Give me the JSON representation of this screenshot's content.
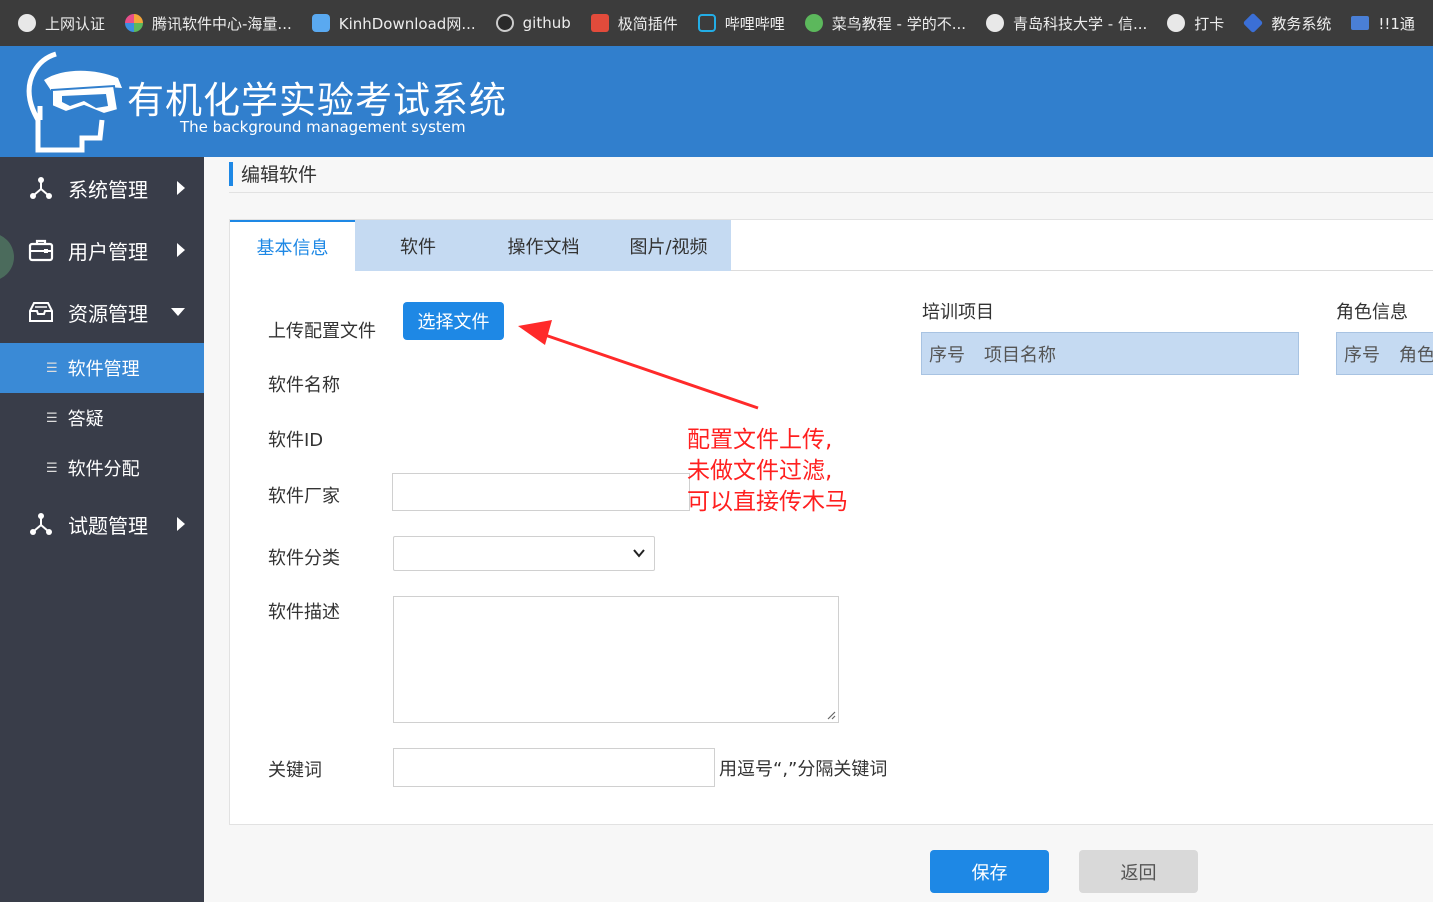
{
  "bookmarks": [
    {
      "label": "上网认证",
      "icon": "globe-icon",
      "color": "#e8e8e8"
    },
    {
      "label": "腾讯软件中心-海量...",
      "icon": "tencent-icon",
      "color": "#f4a43a"
    },
    {
      "label": "KinhDownload网...",
      "icon": "cloud-icon",
      "color": "#5aa9f0"
    },
    {
      "label": "github",
      "icon": "github-icon",
      "color": "#cccccc"
    },
    {
      "label": "极简插件",
      "icon": "house-icon",
      "color": "#e24b3b"
    },
    {
      "label": "哔哩哔哩",
      "icon": "tv-icon",
      "color": "#23ade5"
    },
    {
      "label": "菜鸟教程 - 学的不...",
      "icon": "code-icon",
      "color": "#5cb85c"
    },
    {
      "label": "青岛科技大学 - 信...",
      "icon": "globe-icon",
      "color": "#e8e8e8"
    },
    {
      "label": "打卡",
      "icon": "globe-icon",
      "color": "#e8e8e8"
    },
    {
      "label": "教务系统",
      "icon": "cube-icon",
      "color": "#3b6fd6"
    },
    {
      "label": "!!1通",
      "icon": "card-icon",
      "color": "#4a7fd6"
    }
  ],
  "header": {
    "title": "有机化学实验考试系统",
    "subtitle": "The background management system",
    "bg_color": "#317fcd"
  },
  "sidebar": {
    "items": [
      {
        "label": "系统管理",
        "icon": "network-icon"
      },
      {
        "label": "用户管理",
        "icon": "briefcase-icon"
      },
      {
        "label": "资源管理",
        "icon": "inbox-icon"
      }
    ],
    "subitems": [
      {
        "label": "软件管理",
        "active": true
      },
      {
        "label": "答疑"
      },
      {
        "label": "软件分配"
      }
    ],
    "last_item": {
      "label": "试题管理",
      "icon": "network-icon"
    }
  },
  "page": {
    "title": "编辑软件",
    "tabs": [
      "基本信息",
      "软件",
      "操作文档",
      "图片/视频"
    ],
    "active_tab": "基本信息"
  },
  "form": {
    "upload_label": "上传配置文件",
    "upload_button": "选择文件",
    "name_label": "软件名称",
    "id_label": "软件ID",
    "vendor_label": "软件厂家",
    "vendor_value": "",
    "category_label": "软件分类",
    "category_value": "",
    "desc_label": "软件描述",
    "desc_value": "",
    "keyword_label": "关键词",
    "keyword_value": "",
    "keyword_hint": "用逗号“,”分隔关键词"
  },
  "training": {
    "label": "培训项目",
    "columns": [
      "序号",
      "项目名称"
    ]
  },
  "roles": {
    "label": "角色信息",
    "columns": [
      "序号",
      "角色"
    ]
  },
  "annotation": {
    "lines": [
      "配置文件上传,",
      "未做文件过滤,",
      "可以直接传木马"
    ],
    "color": "#ff1f1f"
  },
  "actions": {
    "save": "保存",
    "back": "返回"
  }
}
